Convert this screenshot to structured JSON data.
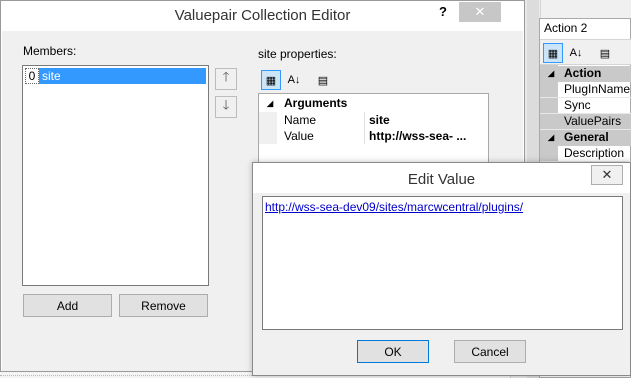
{
  "background_panel": {
    "title": "Action 2",
    "categories": [
      {
        "name": "Action",
        "items": [
          "PlugInName",
          "Sync",
          "ValuePairs"
        ]
      },
      {
        "name": "General",
        "items": [
          "Description"
        ]
      }
    ],
    "selected_item": "ValuePairs",
    "toolbar": {
      "categorized_icon": "categorized-icon",
      "alphabetical_icon": "alphabetical-icon",
      "pages_icon": "property-pages-icon"
    }
  },
  "collection_editor": {
    "title": "Valuepair Collection Editor",
    "help_label": "?",
    "close_label": "✕",
    "members_label": "Members:",
    "members": [
      {
        "index": "0",
        "name": "site"
      }
    ],
    "up_icon": "🡑",
    "down_icon": "🡓",
    "add_label": "Add",
    "remove_label": "Remove",
    "properties_label": "site properties:",
    "property_grid": {
      "category": "Arguments",
      "rows": [
        {
          "name": "Name",
          "value": "site"
        },
        {
          "name": "Value",
          "value": "http://wss-sea- ..."
        }
      ]
    }
  },
  "edit_value": {
    "title": "Edit Value",
    "close_label": "✕",
    "text": "http://wss-sea-dev09/sites/marcwcentral/plugins/",
    "ok_label": "OK",
    "cancel_label": "Cancel"
  },
  "colors": {
    "selection": "#3399ff",
    "category_bg": "#c9c9c9",
    "link": "#0000cc",
    "close_button_bg": "#c7c7c7"
  }
}
